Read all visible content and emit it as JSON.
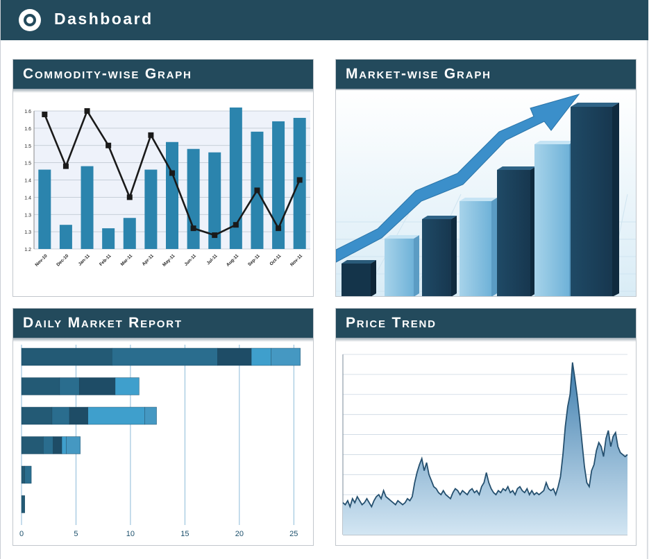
{
  "header": {
    "title": "Dashboard",
    "icon": "target-icon"
  },
  "panels": {
    "commodity": {
      "title": "Commodity-wise Graph"
    },
    "market": {
      "title": "Market-wise Graph"
    },
    "daily": {
      "title": "Daily Market Report"
    },
    "price": {
      "title": "Price Trend"
    }
  },
  "colors": {
    "header": "#234a5c",
    "bar": "#2b84ad",
    "dark": "#1b4f6b",
    "light": "#3f9fcc"
  },
  "chart_data": [
    {
      "type": "bar",
      "categories": [
        "Nov-10",
        "Dec-10",
        "Jan-11",
        "Feb-11",
        "Mar-11",
        "Apr-11",
        "May-11",
        "Jun-11",
        "Jul-11",
        "Aug-11",
        "Sep-11",
        "Oct-11",
        "Nov-11"
      ],
      "yticks": [
        "1.2",
        "1.3",
        "1.3",
        "1.4",
        "1.4",
        "1.5",
        "1.5",
        "1.6",
        "1.6"
      ],
      "ylim": [
        1.2,
        1.6
      ],
      "series": [
        {
          "type": "bar",
          "values": [
            1.43,
            1.27,
            1.44,
            1.26,
            1.29,
            1.43,
            1.51,
            1.49,
            1.48,
            1.61,
            1.54,
            1.57,
            1.58
          ]
        },
        {
          "type": "line",
          "values": [
            1.59,
            1.44,
            1.6,
            1.5,
            1.35,
            1.53,
            1.42,
            1.26,
            1.24,
            1.27,
            1.37,
            1.26,
            1.4
          ]
        }
      ]
    },
    {
      "type": "bar",
      "orientation": "horizontal",
      "stacked": true,
      "xticks": [
        "0",
        "5",
        "10",
        "15",
        "20",
        "25"
      ],
      "xlim": [
        0,
        26
      ],
      "rows": [
        [
          8.3,
          9.7,
          3.1,
          1.8,
          2.7
        ],
        [
          3.5,
          1.8,
          3.3,
          2.2
        ],
        [
          2.8,
          1.6,
          1.7,
          5.2,
          1.1
        ],
        [
          2.0,
          0.9,
          0.8,
          0.4,
          1.3
        ],
        [
          0.3,
          0.6
        ],
        [
          0.3
        ]
      ]
    },
    {
      "type": "area",
      "n_points": 120,
      "ylim": [
        0,
        9
      ],
      "values": [
        1.6,
        1.5,
        1.7,
        1.4,
        1.8,
        1.6,
        1.9,
        1.7,
        1.5,
        1.6,
        1.8,
        1.6,
        1.4,
        1.7,
        1.9,
        2.0,
        1.8,
        2.2,
        1.9,
        1.8,
        1.7,
        1.6,
        1.5,
        1.7,
        1.6,
        1.5,
        1.6,
        1.8,
        1.7,
        1.9,
        2.6,
        3.1,
        3.5,
        3.8,
        3.2,
        3.6,
        3.0,
        2.7,
        2.4,
        2.3,
        2.1,
        2.0,
        2.2,
        2.0,
        1.9,
        1.8,
        2.1,
        2.3,
        2.2,
        2.0,
        2.2,
        2.1,
        2.0,
        2.2,
        2.3,
        2.1,
        2.2,
        2.0,
        2.4,
        2.6,
        3.1,
        2.6,
        2.3,
        2.1,
        2.0,
        2.2,
        2.1,
        2.3,
        2.2,
        2.4,
        2.1,
        2.2,
        2.0,
        2.3,
        2.4,
        2.2,
        2.1,
        2.3,
        2.0,
        2.2,
        2.0,
        2.1,
        2.0,
        2.1,
        2.2,
        2.6,
        2.3,
        2.2,
        2.3,
        2.0,
        2.4,
        2.9,
        4.0,
        5.4,
        6.4,
        7.0,
        8.6,
        7.8,
        6.9,
        5.8,
        4.6,
        3.4,
        2.6,
        2.4,
        3.2,
        3.5,
        4.2,
        4.6,
        4.4,
        3.9,
        4.8,
        5.2,
        4.4,
        4.9,
        5.1,
        4.4,
        4.1,
        4.0,
        3.9,
        4.0
      ]
    }
  ]
}
